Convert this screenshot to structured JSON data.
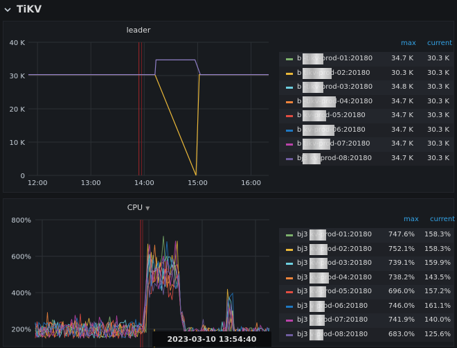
{
  "row": {
    "title": "TiKV"
  },
  "leader_panel": {
    "title": "leader",
    "legend_headers": {
      "max": "max",
      "current": "current"
    },
    "series": [
      {
        "name": "b        -tikv-prod-01:20180",
        "color": "#7eb26d",
        "max": "34.7 K",
        "current": "30.3 K"
      },
      {
        "name": "b         tikv-prod-02:20180",
        "color": "#eab839",
        "max": "30.3 K",
        "current": "30.3 K"
      },
      {
        "name": "b        -tikv-prod-03:20180",
        "color": "#6ed0e0",
        "max": "34.8 K",
        "current": "30.3 K"
      },
      {
        "name": "b          -tikv-prod-04:20180",
        "color": "#ef843c",
        "max": "34.7 K",
        "current": "30.3 K"
      },
      {
        "name": "b           kv-prod-05:20180",
        "color": "#e24d42",
        "max": "34.7 K",
        "current": "30.3 K"
      },
      {
        "name": "b           kv-prod-06:20180",
        "color": "#1f78c1",
        "max": "34.7 K",
        "current": "30.3 K"
      },
      {
        "name": "b          tikv-prod-07:20180",
        "color": "#ba43a9",
        "max": "34.7 K",
        "current": "30.3 K"
      },
      {
        "name": "bj3        kv-prod-08:20180",
        "color": "#705da0",
        "max": "34.7 K",
        "current": "30.3 K"
      }
    ]
  },
  "cpu_panel": {
    "title": "CPU",
    "legend_headers": {
      "max": "max",
      "current": "current"
    },
    "series": [
      {
        "name": "bj3          kv-prod-01:20180",
        "color": "#7eb26d",
        "max": "747.6%",
        "current": "158.3%"
      },
      {
        "name": "bj3          kv-prod-02:20180",
        "color": "#eab839",
        "max": "752.1%",
        "current": "158.3%"
      },
      {
        "name": "bj3          kv-prod-03:20180",
        "color": "#6ed0e0",
        "max": "739.1%",
        "current": "159.9%"
      },
      {
        "name": "bj3          kv-prod-04:20180",
        "color": "#ef843c",
        "max": "738.2%",
        "current": "143.5%"
      },
      {
        "name": "bj3          kv-prod-05:20180",
        "color": "#e24d42",
        "max": "696.0%",
        "current": "157.2%"
      },
      {
        "name": "bj3          v-prod-06:20180",
        "color": "#1f78c1",
        "max": "746.0%",
        "current": "161.1%"
      },
      {
        "name": "bj3          v-prod-07:20180",
        "color": "#ba43a9",
        "max": "741.9%",
        "current": "140.0%"
      },
      {
        "name": "bj3          v-prod-08:20180",
        "color": "#705da0",
        "max": "683.0%",
        "current": "125.6%"
      }
    ]
  },
  "tooltip": {
    "time": "2023-03-10 13:54:40"
  },
  "chart_data": [
    {
      "type": "line",
      "title": "leader",
      "x_ticks": [
        "12:00",
        "13:00",
        "14:00",
        "15:00",
        "16:00"
      ],
      "y_ticks": [
        "0",
        "10 K",
        "20 K",
        "30 K",
        "40 K"
      ],
      "ylim": [
        0,
        40000
      ],
      "xlim_hours": [
        11.83,
        16.33
      ],
      "grid": true,
      "legend": "right",
      "series": [
        {
          "name": "tikv-prod-08",
          "x": [
            11.83,
            14.2,
            14.22,
            14.95,
            15.05,
            16.33
          ],
          "y": [
            30300,
            30300,
            34700,
            34700,
            30300,
            30300
          ]
        },
        {
          "name": "tikv-prod-02",
          "x": [
            11.83,
            14.2,
            14.97,
            15.03,
            16.33
          ],
          "y": [
            30300,
            30300,
            0,
            30300,
            30300
          ]
        }
      ]
    },
    {
      "type": "line",
      "title": "CPU",
      "y_ticks": [
        "200%",
        "400%",
        "600%",
        "800%"
      ],
      "ylim": [
        100,
        800
      ],
      "grid": true,
      "legend": "right",
      "series_count": 8,
      "series_max": [
        747.6,
        752.1,
        739.1,
        738.2,
        696.0,
        746.0,
        741.9,
        683.0
      ],
      "series_current": [
        158.3,
        158.3,
        159.9,
        143.5,
        157.2,
        161.1,
        140.0,
        125.6
      ]
    }
  ]
}
